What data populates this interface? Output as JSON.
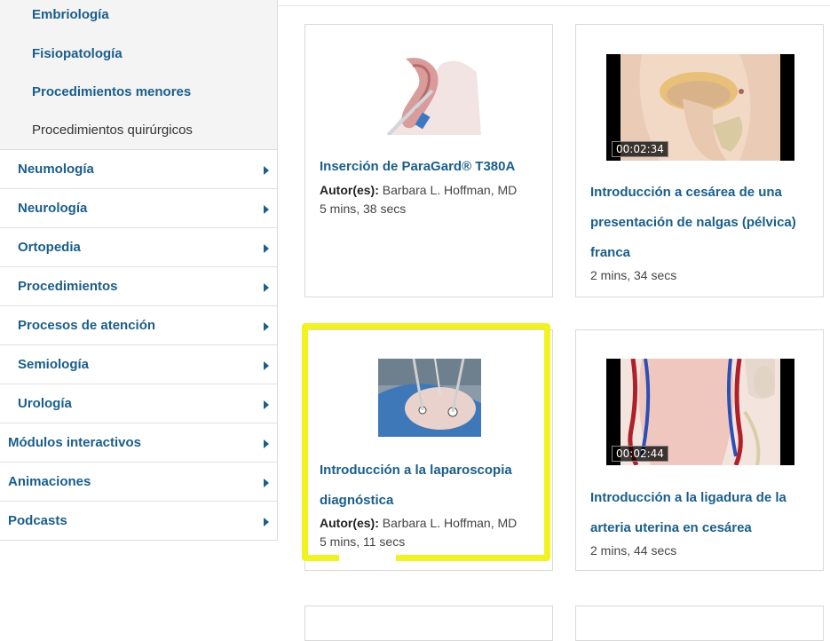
{
  "sidebar": {
    "subitems": [
      {
        "label": "Embriología"
      },
      {
        "label": "Fisiopatología"
      },
      {
        "label": "Procedimientos menores"
      },
      {
        "label": "Procedimientos quirúrgicos"
      }
    ],
    "items_level2": [
      {
        "label": "Neumología"
      },
      {
        "label": "Neurología"
      },
      {
        "label": "Ortopedia"
      },
      {
        "label": "Procedimientos"
      },
      {
        "label": "Procesos de atención"
      },
      {
        "label": "Semiología"
      },
      {
        "label": "Urología"
      }
    ],
    "items_level1": [
      {
        "label": "Módulos interactivos"
      },
      {
        "label": "Animaciones"
      },
      {
        "label": "Podcasts"
      }
    ]
  },
  "cards": [
    {
      "title": "Inserción de ParaGard® T380A",
      "author_label": "Autor(es):",
      "author": " Barbara L. Hoffman, MD",
      "duration": "5 mins, 38 secs"
    },
    {
      "title_lines": [
        "Introducción a cesárea de una",
        "presentación de nalgas (pélvica)",
        "franca"
      ],
      "duration": "2 mins, 34 secs",
      "timestamp": "00:02:34"
    },
    {
      "title_lines": [
        "Introducción a la laparoscopia",
        "diagnóstica"
      ],
      "author_label": "Autor(es):",
      "author": " Barbara L. Hoffman, MD",
      "duration": "5 mins, 11 secs"
    },
    {
      "title_lines": [
        "Introducción a la ligadura de la",
        "arteria uterina en cesárea"
      ],
      "duration": "2 mins, 44 secs",
      "timestamp": "00:02:44"
    }
  ],
  "colors": {
    "link": "#1a5e8a",
    "highlight": "#f2f21e"
  }
}
